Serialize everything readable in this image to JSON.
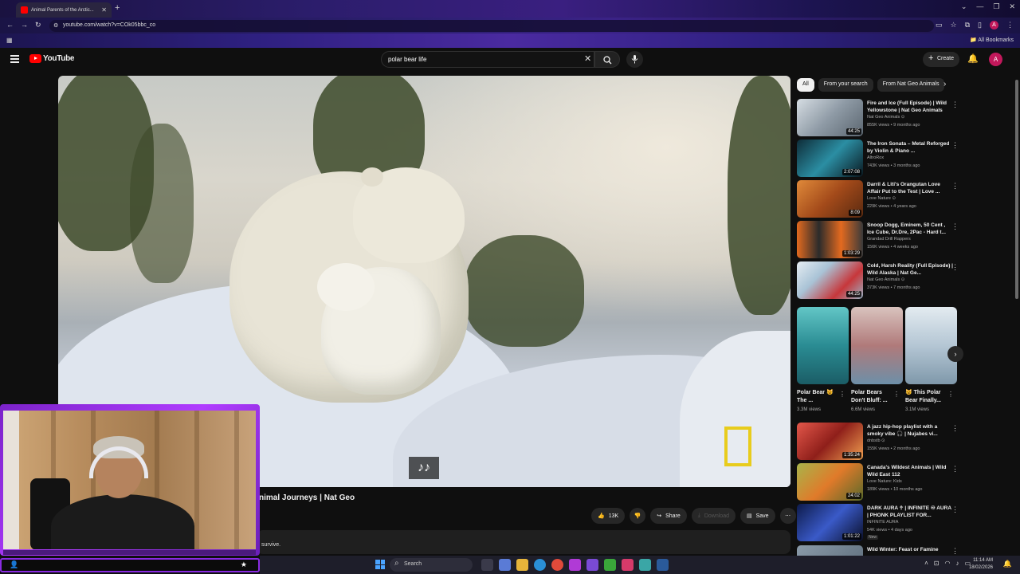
{
  "browser": {
    "tab_title": "Animal Parents of the Arctic...",
    "new_tab": "+",
    "url": "youtube.com/watch?v=COk05bbc_co",
    "all_bookmarks": "All Bookmarks",
    "profile_initial": "A"
  },
  "youtube": {
    "logo_text": "YouTube",
    "search_value": "polar bear life",
    "create_label": "Create",
    "account_initial": "A"
  },
  "video": {
    "title_visible": "nimal Journeys | Nat Geo",
    "likes": "13K",
    "share_label": "Share",
    "download_label": "Download",
    "save_label": "Save",
    "description_snippet": "survive."
  },
  "chips": [
    "All",
    "From your search",
    "From Nat Geo Animals"
  ],
  "recommendations": [
    {
      "title": "Fire and Ice (Full Episode) | Wild Yellowstone | Nat Geo Animals",
      "channel": "Nat Geo Animals ⊙",
      "meta": "855K views • 9 months ago",
      "duration": "44:25",
      "thumb_color": "#9aa7b3"
    },
    {
      "title": "The Iron Sonata – Metal Reforged by Violin & Piano ...",
      "channel": "AltroRox",
      "meta": "743K views • 3 months ago",
      "duration": "2:07:08",
      "thumb_color": "#1f5b6e"
    },
    {
      "title": "Darril & Liti's Orangutan Love Affair Put to the Test | Love ...",
      "channel": "Love Nature ⊙",
      "meta": "229K views • 4 years ago",
      "duration": "8:09",
      "thumb_color": "#c7652a"
    },
    {
      "title": "Snoop Dogg, Eminem, 50 Cent , Ice Cube, Dr.Dre, 2Pac - Hard t...",
      "channel": "Grandad Drill Rappers",
      "meta": "156K views • 4 weeks ago",
      "duration": "1:03:29",
      "thumb_color": "#c0461d"
    },
    {
      "title": "Cold, Harsh Reality (Full Episode) | Wild Alaska | Nat Ge...",
      "channel": "Nat Geo Animals ⊙",
      "meta": "373K views • 7 months ago",
      "duration": "44:25",
      "thumb_color": "#b9c8d6"
    },
    {
      "title": "A jazz hip-hop playlist with a smoky vibe 🎧 | Nujabes vi...",
      "channel": "dnbstb ⊙",
      "meta": "155K views • 2 months ago",
      "duration": "1:35:24",
      "thumb_color": "#b8332b"
    },
    {
      "title": "Canada's Wildest Animals | Wild Wild East 112",
      "channel": "Love Nature: Kids",
      "meta": "189K views • 10 months ago",
      "duration": "24:02",
      "thumb_color": "#8a9a3a"
    },
    {
      "title": "DARK AURA ☥ | INFINITE ♾ AURA | PHONK PLAYLIST FOR...",
      "channel": "INFINITE AURA",
      "meta": "54K views • 4 days ago",
      "duration": "1:01:22",
      "badge": "New",
      "thumb_color": "#1a2a6a"
    },
    {
      "title": "Wild Winter: Feast or Famine",
      "channel": "",
      "meta": "",
      "duration": "",
      "thumb_color": "#6a7a88"
    }
  ],
  "shorts": [
    {
      "title": "Polar Bear 😺 The ...",
      "views": "3.3M views",
      "color": "#3aa6a6"
    },
    {
      "title": "Polar Bears Don't Bluff: ...",
      "views": "6.6M views",
      "color": "#c4a8a8"
    },
    {
      "title": "😺 This Polar Bear Finally...",
      "views": "3.1M views",
      "color": "#b7c8d3"
    }
  ],
  "webcam": {
    "left_icon": "person-icon",
    "right_icon": "star-icon"
  },
  "taskbar": {
    "search_label": "Search",
    "time": "11:14 AM",
    "date": "18/02/2026"
  }
}
